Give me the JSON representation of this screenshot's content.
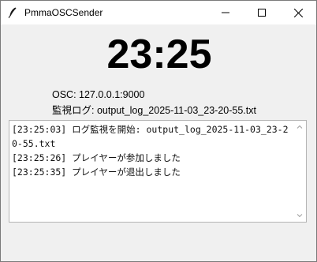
{
  "window": {
    "title": "PmmaOSCSender",
    "icon": "feather-icon"
  },
  "clock": {
    "time": "23:25"
  },
  "info": {
    "osc": "OSC: 127.0.0.1:9000",
    "log": "監視ログ: output_log_2025-11-03_23-20-55.txt"
  },
  "log": {
    "lines": [
      "[23:25:03] ログ監視を開始: output_log_2025-11-03_23-20-55.txt",
      "[23:25:26] プレイヤーが参加しました",
      "[23:25:35] プレイヤーが退出しました"
    ]
  },
  "colors": {
    "titlebar": "#ffffff",
    "background": "#f0f0f0",
    "log_background": "#ffffff",
    "text": "#000000"
  }
}
